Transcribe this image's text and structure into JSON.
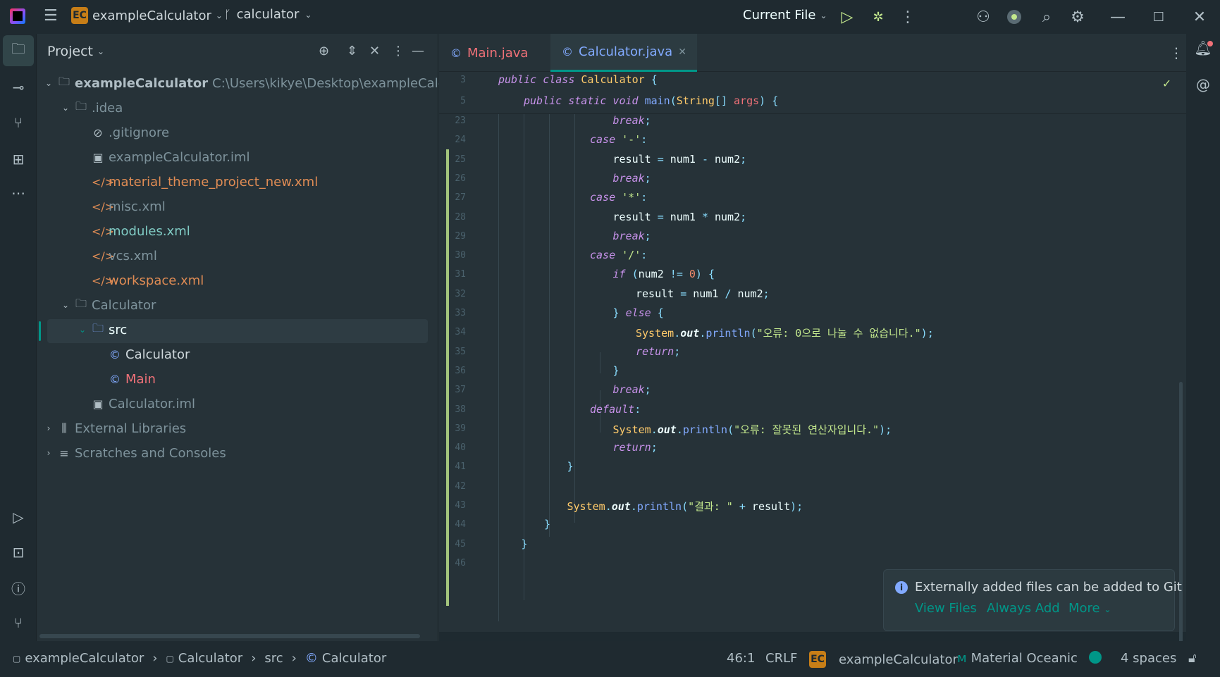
{
  "titlebar": {
    "project_badge": "EC",
    "project_name": "exampleCalculator",
    "branch": "calculator",
    "run_config": "Current File"
  },
  "project_panel": {
    "title": "Project",
    "tree": [
      {
        "label": "exampleCalculator",
        "path": "C:\\Users\\kikye\\Desktop\\exampleCalculat"
      },
      {
        "label": ".idea"
      },
      {
        "label": ".gitignore"
      },
      {
        "label": "exampleCalculator.iml"
      },
      {
        "label": "material_theme_project_new.xml"
      },
      {
        "label": "misc.xml"
      },
      {
        "label": "modules.xml"
      },
      {
        "label": "vcs.xml"
      },
      {
        "label": "workspace.xml"
      },
      {
        "label": "Calculator"
      },
      {
        "label": "src"
      },
      {
        "label": "Calculator"
      },
      {
        "label": "Main"
      },
      {
        "label": "Calculator.iml"
      },
      {
        "label": "External Libraries"
      },
      {
        "label": "Scratches and Consoles"
      }
    ]
  },
  "editor": {
    "tabs": [
      {
        "label": "Main.java"
      },
      {
        "label": "Calculator.java"
      }
    ],
    "sticky": [
      {
        "ln": "3",
        "text": "public class Calculator {"
      },
      {
        "ln": "5",
        "text": "public static void main(String[] args) {"
      }
    ],
    "lines": [
      {
        "ln": "23",
        "code": "break;"
      },
      {
        "ln": "24",
        "code": "case '-':"
      },
      {
        "ln": "25",
        "code": "result = num1 - num2;"
      },
      {
        "ln": "26",
        "code": "break;"
      },
      {
        "ln": "27",
        "code": "case '*':"
      },
      {
        "ln": "28",
        "code": "result = num1 * num2;"
      },
      {
        "ln": "29",
        "code": "break;"
      },
      {
        "ln": "30",
        "code": "case '/':"
      },
      {
        "ln": "31",
        "code": "if (num2 != 0) {"
      },
      {
        "ln": "32",
        "code": "result = num1 / num2;"
      },
      {
        "ln": "33",
        "code": "} else {"
      },
      {
        "ln": "34",
        "code": "System.out.println(\"오류: 0으로 나눌 수 없습니다.\");"
      },
      {
        "ln": "35",
        "code": "return;"
      },
      {
        "ln": "36",
        "code": "}"
      },
      {
        "ln": "37",
        "code": "break;"
      },
      {
        "ln": "38",
        "code": "default:"
      },
      {
        "ln": "39",
        "code": "System.out.println(\"오류: 잘못된 연산자입니다.\");"
      },
      {
        "ln": "40",
        "code": "return;"
      },
      {
        "ln": "41",
        "code": "}"
      },
      {
        "ln": "42",
        "code": ""
      },
      {
        "ln": "43",
        "code": "System.out.println(\"결과: \" + result);"
      },
      {
        "ln": "44",
        "code": "}"
      },
      {
        "ln": "45",
        "code": "}"
      },
      {
        "ln": "46",
        "code": ""
      }
    ]
  },
  "notification": {
    "message": "Externally added files can be added to Git",
    "actions": [
      "View Files",
      "Always Add",
      "More"
    ]
  },
  "statusbar": {
    "breadcrumb": [
      "exampleCalculator",
      "Calculator",
      "src",
      "Calculator"
    ],
    "position": "46:1",
    "line_sep": "CRLF",
    "project_badge": "EC",
    "project": "exampleCalculator",
    "theme": "Material Oceanic",
    "indent": "4 spaces"
  },
  "colors": {
    "accent": "#009688",
    "background": "#263238",
    "chrome": "#1f2a30"
  }
}
